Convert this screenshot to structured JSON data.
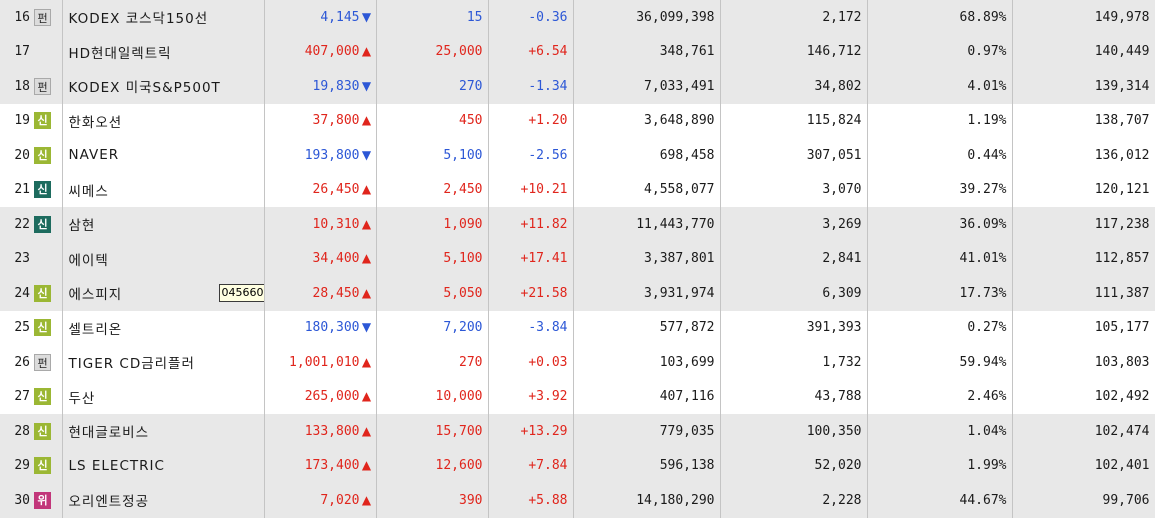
{
  "rows": [
    {
      "rank": "16",
      "badge": "펀",
      "badge_type": "fund",
      "name": "KODEX 코스닥150선",
      "price": "4,145",
      "dir": "down",
      "change": "15",
      "rate": "-0.36",
      "volume": "36,099,398",
      "v2": "2,172",
      "pct": "68.89%",
      "amount": "149,978",
      "bg": "gray"
    },
    {
      "rank": "17",
      "badge": "",
      "badge_type": "none",
      "name": "HD현대일렉트릭",
      "price": "407,000",
      "dir": "up",
      "change": "25,000",
      "rate": "+6.54",
      "volume": "348,761",
      "v2": "146,712",
      "pct": "0.97%",
      "amount": "140,449",
      "bg": "gray"
    },
    {
      "rank": "18",
      "badge": "펀",
      "badge_type": "fund",
      "name": "KODEX 미국S&P500T",
      "price": "19,830",
      "dir": "down",
      "change": "270",
      "rate": "-1.34",
      "volume": "7,033,491",
      "v2": "34,802",
      "pct": "4.01%",
      "amount": "139,314",
      "bg": "gray"
    },
    {
      "rank": "19",
      "badge": "신",
      "badge_type": "new",
      "name": "한화오션",
      "price": "37,800",
      "dir": "up",
      "change": "450",
      "rate": "+1.20",
      "volume": "3,648,890",
      "v2": "115,824",
      "pct": "1.19%",
      "amount": "138,707",
      "bg": "white"
    },
    {
      "rank": "20",
      "badge": "신",
      "badge_type": "new",
      "name": "NAVER",
      "price": "193,800",
      "dir": "down",
      "change": "5,100",
      "rate": "-2.56",
      "volume": "698,458",
      "v2": "307,051",
      "pct": "0.44%",
      "amount": "136,012",
      "bg": "white"
    },
    {
      "rank": "21",
      "badge": "신",
      "badge_type": "newd",
      "name": "씨메스",
      "price": "26,450",
      "dir": "up",
      "change": "2,450",
      "rate": "+10.21",
      "volume": "4,558,077",
      "v2": "3,070",
      "pct": "39.27%",
      "amount": "120,121",
      "bg": "white"
    },
    {
      "rank": "22",
      "badge": "신",
      "badge_type": "newd",
      "name": "삼현",
      "price": "10,310",
      "dir": "up",
      "change": "1,090",
      "rate": "+11.82",
      "volume": "11,443,770",
      "v2": "3,269",
      "pct": "36.09%",
      "amount": "117,238",
      "bg": "gray"
    },
    {
      "rank": "23",
      "badge": "",
      "badge_type": "none",
      "name": "에이텍",
      "price": "34,400",
      "dir": "up",
      "change": "5,100",
      "rate": "+17.41",
      "volume": "3,387,801",
      "v2": "2,841",
      "pct": "41.01%",
      "amount": "112,857",
      "bg": "gray"
    },
    {
      "rank": "24",
      "badge": "신",
      "badge_type": "new",
      "name": "에스피지",
      "tooltip": "045660",
      "price": "28,450",
      "dir": "up",
      "change": "5,050",
      "rate": "+21.58",
      "volume": "3,931,974",
      "v2": "6,309",
      "pct": "17.73%",
      "amount": "111,387",
      "bg": "gray"
    },
    {
      "rank": "25",
      "badge": "신",
      "badge_type": "new",
      "name": "셀트리온",
      "price": "180,300",
      "dir": "down",
      "change": "7,200",
      "rate": "-3.84",
      "volume": "577,872",
      "v2": "391,393",
      "pct": "0.27%",
      "amount": "105,177",
      "bg": "white"
    },
    {
      "rank": "26",
      "badge": "펀",
      "badge_type": "fund",
      "name": "TIGER CD금리플러",
      "price": "1,001,010",
      "dir": "up",
      "change": "270",
      "rate": "+0.03",
      "volume": "103,699",
      "v2": "1,732",
      "pct": "59.94%",
      "amount": "103,803",
      "bg": "white"
    },
    {
      "rank": "27",
      "badge": "신",
      "badge_type": "new",
      "name": "두산",
      "price": "265,000",
      "dir": "up",
      "change": "10,000",
      "rate": "+3.92",
      "volume": "407,116",
      "v2": "43,788",
      "pct": "2.46%",
      "amount": "102,492",
      "bg": "white"
    },
    {
      "rank": "28",
      "badge": "신",
      "badge_type": "new",
      "name": "현대글로비스",
      "price": "133,800",
      "dir": "up",
      "change": "15,700",
      "rate": "+13.29",
      "volume": "779,035",
      "v2": "100,350",
      "pct": "1.04%",
      "amount": "102,474",
      "bg": "gray"
    },
    {
      "rank": "29",
      "badge": "신",
      "badge_type": "new",
      "name": "LS ELECTRIC",
      "price": "173,400",
      "dir": "up",
      "change": "12,600",
      "rate": "+7.84",
      "volume": "596,138",
      "v2": "52,020",
      "pct": "1.99%",
      "amount": "102,401",
      "bg": "gray"
    },
    {
      "rank": "30",
      "badge": "위",
      "badge_type": "warn",
      "name": "오리엔트정공",
      "price": "7,020",
      "dir": "up",
      "change": "390",
      "rate": "+5.88",
      "volume": "14,180,290",
      "v2": "2,228",
      "pct": "44.67%",
      "amount": "99,706",
      "bg": "gray"
    }
  ],
  "icons": {
    "up": "▲",
    "down": "▼"
  },
  "colors": {
    "up": "#e0251c",
    "down": "#2c57d6",
    "badge_new": "#9bb734",
    "badge_new_dark": "#1d6b5e",
    "badge_warn": "#c2367a",
    "row_gray": "#e8e8e8"
  }
}
